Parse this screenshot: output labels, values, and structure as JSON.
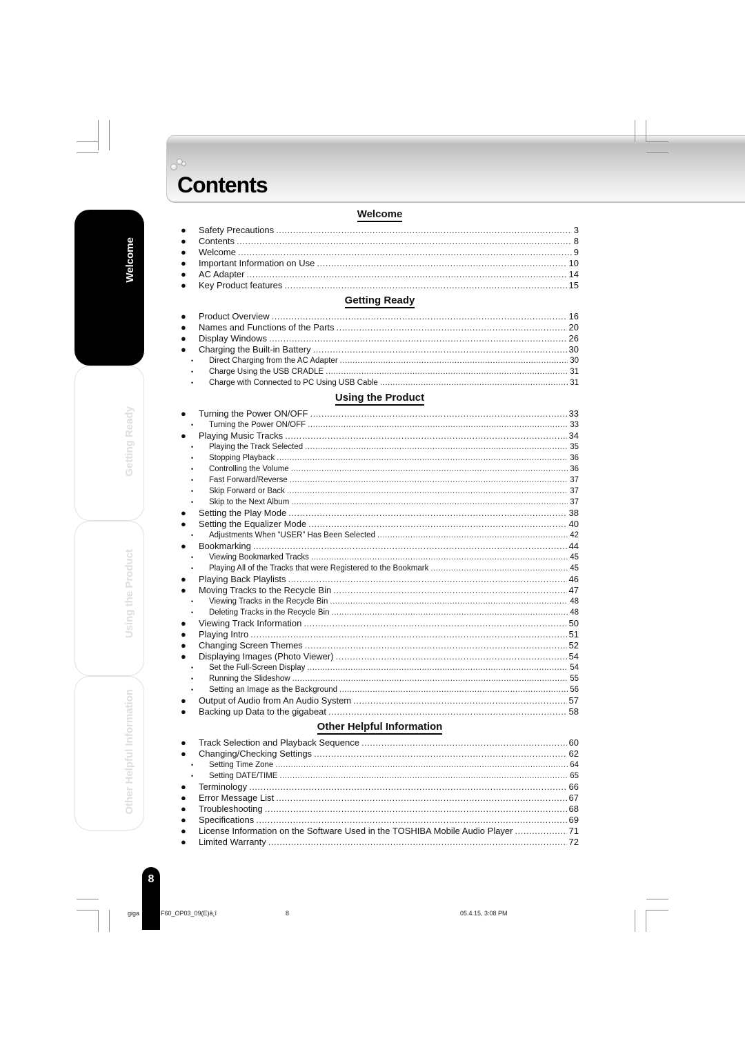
{
  "page_title": "Contents",
  "side_tabs": [
    {
      "label": "Welcome",
      "active": true
    },
    {
      "label": "Getting Ready",
      "active": false
    },
    {
      "label": "Using the Product",
      "active": false
    },
    {
      "label": "Other Helpful Information",
      "active": false
    }
  ],
  "page_number": "8",
  "sections": [
    {
      "heading": "Welcome",
      "entries": [
        {
          "level": 1,
          "title": "Safety Precautions",
          "page": "3"
        },
        {
          "level": 1,
          "title": "Contents",
          "page": "8"
        },
        {
          "level": 1,
          "title": "Welcome",
          "page": "9"
        },
        {
          "level": 1,
          "title": "Important Information on Use",
          "page": "10"
        },
        {
          "level": 1,
          "title": "AC Adapter",
          "page": "14"
        },
        {
          "level": 1,
          "title": "Key Product features",
          "page": "15"
        }
      ]
    },
    {
      "heading": "Getting Ready",
      "entries": [
        {
          "level": 1,
          "title": "Product Overview",
          "page": "16"
        },
        {
          "level": 1,
          "title": "Names and Functions of the Parts",
          "page": "20"
        },
        {
          "level": 1,
          "title": "Display Windows",
          "page": "26"
        },
        {
          "level": 1,
          "title": "Charging the Built-in Battery",
          "page": "30"
        },
        {
          "level": 2,
          "title": "Direct Charging from the AC Adapter",
          "page": "30"
        },
        {
          "level": 2,
          "title": "Charge Using the USB CRADLE",
          "page": "31"
        },
        {
          "level": 2,
          "title": "Charge with Connected to PC Using USB Cable",
          "page": "31"
        }
      ]
    },
    {
      "heading": "Using the Product",
      "entries": [
        {
          "level": 1,
          "title": "Turning the Power ON/OFF",
          "page": "33"
        },
        {
          "level": 2,
          "title": "Turning the Power ON/OFF",
          "page": "33"
        },
        {
          "level": 1,
          "title": "Playing Music Tracks",
          "page": "34"
        },
        {
          "level": 2,
          "title": "Playing the Track Selected",
          "page": "35"
        },
        {
          "level": 2,
          "title": "Stopping Playback",
          "page": "36"
        },
        {
          "level": 2,
          "title": "Controlling the Volume",
          "page": "36"
        },
        {
          "level": 2,
          "title": "Fast Forward/Reverse",
          "page": "37"
        },
        {
          "level": 2,
          "title": "Skip Forward or Back",
          "page": "37"
        },
        {
          "level": 2,
          "title": "Skip to the Next Album",
          "page": "37"
        },
        {
          "level": 1,
          "title": "Setting the Play Mode",
          "page": "38"
        },
        {
          "level": 1,
          "title": "Setting the Equalizer Mode",
          "page": "40"
        },
        {
          "level": 2,
          "title": "Adjustments When “USER” Has Been Selected",
          "page": "42"
        },
        {
          "level": 1,
          "title": "Bookmarking",
          "page": "44"
        },
        {
          "level": 2,
          "title": "Viewing Bookmarked Tracks",
          "page": "45"
        },
        {
          "level": 2,
          "title": "Playing All of the Tracks that were Registered to the Bookmark",
          "page": "45"
        },
        {
          "level": 1,
          "title": "Playing Back Playlists",
          "page": "46"
        },
        {
          "level": 1,
          "title": "Moving Tracks to the Recycle Bin",
          "page": "47"
        },
        {
          "level": 2,
          "title": "Viewing Tracks in the Recycle Bin",
          "page": "48"
        },
        {
          "level": 2,
          "title": "Deleting Tracks in the Recycle Bin",
          "page": "48"
        },
        {
          "level": 1,
          "title": "Viewing Track Information",
          "page": "50"
        },
        {
          "level": 1,
          "title": "Playing Intro",
          "page": "51"
        },
        {
          "level": 1,
          "title": "Changing Screen Themes",
          "page": "52"
        },
        {
          "level": 1,
          "title": "Displaying Images (Photo Viewer)",
          "page": "54"
        },
        {
          "level": 2,
          "title": "Set the Full-Screen Display",
          "page": "54"
        },
        {
          "level": 2,
          "title": "Running the Slideshow",
          "page": "55"
        },
        {
          "level": 2,
          "title": "Setting an Image as the Background",
          "page": "56"
        },
        {
          "level": 1,
          "title": "Output of Audio from An Audio System",
          "page": "57"
        },
        {
          "level": 1,
          "title": "Backing up Data to the gigabeat",
          "page": "58"
        }
      ]
    },
    {
      "heading": "Other Helpful Information",
      "entries": [
        {
          "level": 1,
          "title": "Track Selection and Playback Sequence",
          "page": "60"
        },
        {
          "level": 1,
          "title": "Changing/Checking Settings",
          "page": "62"
        },
        {
          "level": 2,
          "title": "Setting Time Zone",
          "page": "64"
        },
        {
          "level": 2,
          "title": "Setting DATE/TIME",
          "page": "65"
        },
        {
          "level": 1,
          "title": "Terminology",
          "page": "66"
        },
        {
          "level": 1,
          "title": "Error Message List",
          "page": "67"
        },
        {
          "level": 1,
          "title": "Troubleshooting",
          "page": "68"
        },
        {
          "level": 1,
          "title": "Specifications",
          "page": "69"
        },
        {
          "level": 1,
          "title": "License Information on the Software Used in the TOSHIBA Mobile Audio Player",
          "page": "71"
        },
        {
          "level": 1,
          "title": "Limited Warranty",
          "page": "72"
        }
      ]
    }
  ],
  "footer": {
    "file_left": "giga",
    "file_right": "F60_OP03_09(E)â¸î",
    "page": "8",
    "timestamp": "05.4.15, 3:08 PM"
  },
  "icons": {
    "bullet_main": "●",
    "bullet_sub": "•"
  }
}
